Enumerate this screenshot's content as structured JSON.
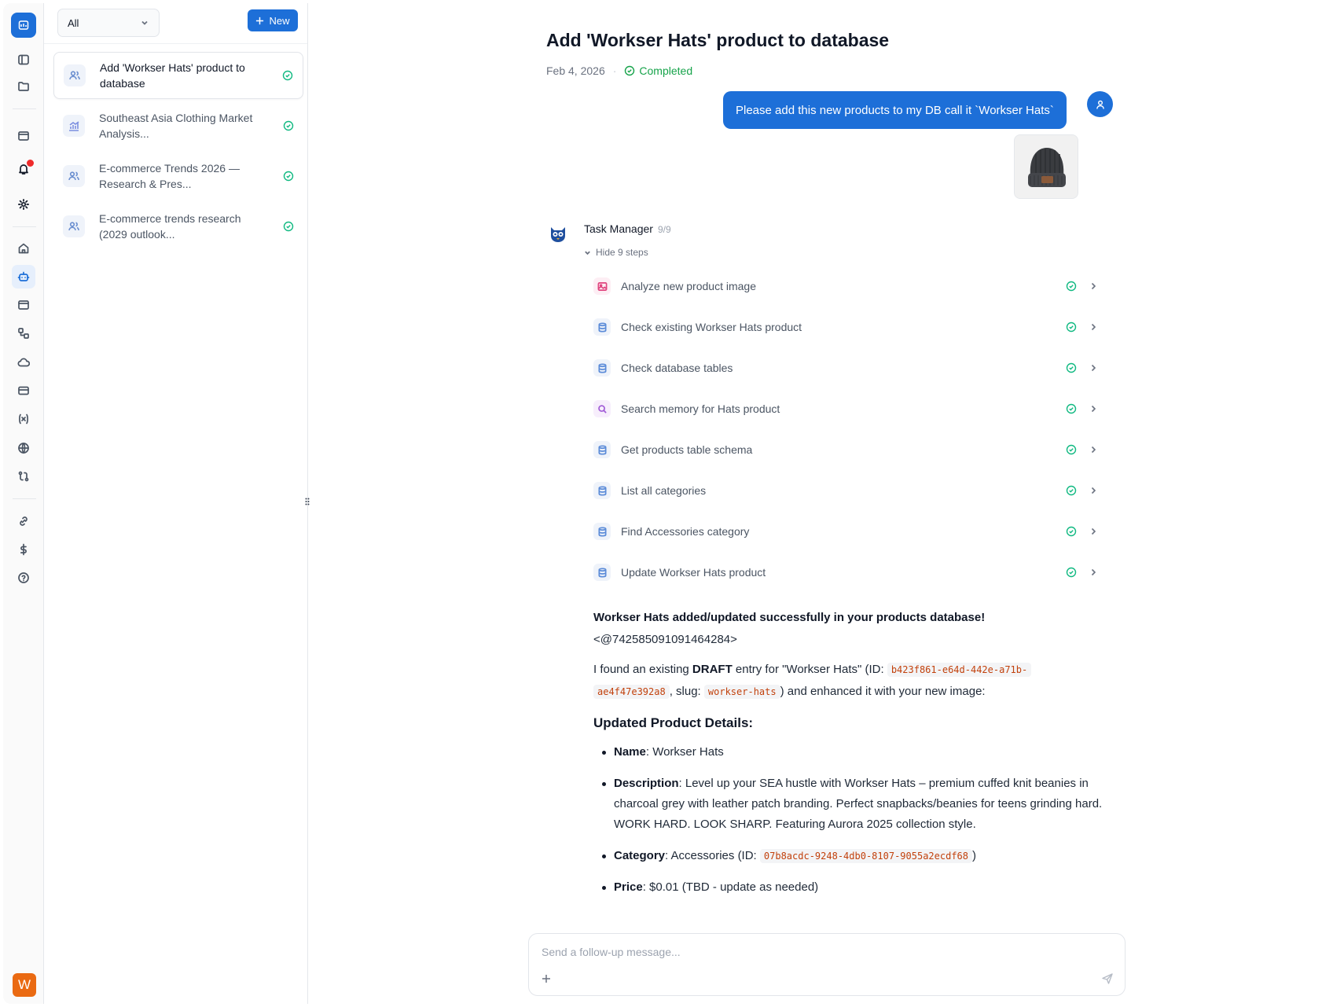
{
  "rail": {
    "items": [
      "logo-icon",
      "sidebar-toggle-icon",
      "folder-icon",
      "browser-icon",
      "bell-icon",
      "settings-icon",
      "home-icon",
      "bot-icon",
      "window-icon",
      "workflow-icon",
      "cloud-icon",
      "card-icon",
      "variable-icon",
      "globe-icon",
      "route-icon",
      "link-icon",
      "dollar-icon",
      "help-icon"
    ],
    "active": "bot-icon",
    "user_initial": "W",
    "colors": {
      "accent": "#1d6fd8",
      "avatar": "#ea6a12",
      "notification": "#ef2b2b"
    }
  },
  "panel": {
    "filter_value": "All",
    "new_label": "New",
    "tasks": [
      {
        "label_1": "Add 'Workser Hats' product to",
        "label_2": "database",
        "icon": "users-icon",
        "status": "completed"
      },
      {
        "label_1": "Southeast Asia Clothing Market",
        "label_2": "Analysis...",
        "icon": "chart-icon",
        "status": "completed"
      },
      {
        "label_1": "E-commerce Trends 2026 —",
        "label_2": "Research & Pres...",
        "icon": "users-icon",
        "status": "completed"
      },
      {
        "label_1": "E-commerce trends research",
        "label_2": "(2029 outlook...",
        "icon": "users-icon",
        "status": "completed"
      }
    ]
  },
  "main": {
    "title": "Add 'Workser Hats' product to database",
    "date": "Feb 4, 2026",
    "dot": "·",
    "status": "Completed",
    "user_message": "Please add this new products to my DB call it `Workser Hats`",
    "agent_name": "Task Manager",
    "agent_count": "9/9",
    "hide_steps": "Hide 9 steps",
    "steps": [
      {
        "label": "Analyze new product image",
        "icon": "image-icon"
      },
      {
        "label": "Check existing Workser Hats product",
        "icon": "database-icon"
      },
      {
        "label": "Check database tables",
        "icon": "database-icon"
      },
      {
        "label": "Search memory for Hats product",
        "icon": "search-icon"
      },
      {
        "label": "Get products table schema",
        "icon": "database-icon"
      },
      {
        "label": "List all categories",
        "icon": "database-icon"
      },
      {
        "label": "Find Accessories category",
        "icon": "database-icon"
      },
      {
        "label": "Update Workser Hats product",
        "icon": "database-icon"
      }
    ],
    "response": {
      "headline": "Workser Hats added/updated successfully in your products database!",
      "mention": "<@742585091091464284>",
      "p1_a": "I found an existing ",
      "p1_b": "DRAFT",
      "p1_c": " entry for \"Workser Hats\" (ID: ",
      "id_code_1": "b423f861-e64d-442e-a71b-",
      "id_code_2": "ae4f47e392a8",
      "p1_d": ", slug: ",
      "slug_code": "workser-hats",
      "p1_e": ") and enhanced it with your new image:",
      "details_heading": "Updated Product Details:",
      "name_label": "Name",
      "name_value": ": Workser Hats",
      "desc_label": "Description",
      "desc_value": ": Level up your SEA hustle with Workser Hats – premium cuffed knit beanies in charcoal grey with leather patch branding. Perfect snapbacks/beanies for teens grinding hard. WORK HARD. LOOK SHARP. Featuring Aurora 2025 collection style.",
      "cat_label": "Category",
      "cat_value": ": Accessories (ID: ",
      "cat_code": "07b8acdc-9248-4db0-8107-9055a2ecdf68",
      "cat_close": ")",
      "price_label": "Price",
      "price_value": ": $0.01 (TBD - update as needed)"
    },
    "composer_placeholder": "Send a follow-up message..."
  }
}
